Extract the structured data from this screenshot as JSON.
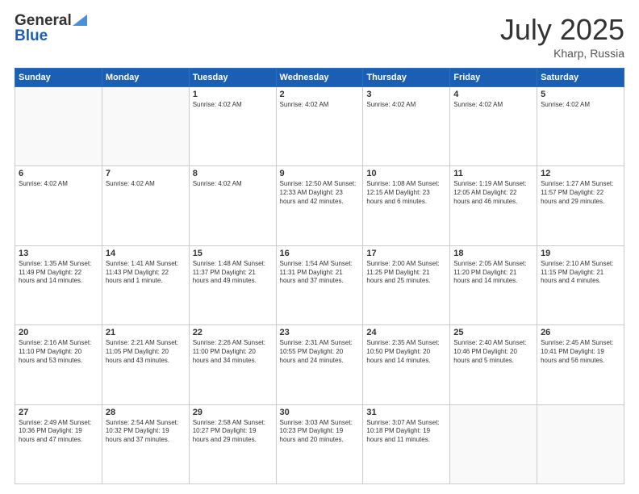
{
  "logo": {
    "line1": "General",
    "line2": "Blue"
  },
  "title": {
    "month_year": "July 2025",
    "location": "Kharp, Russia"
  },
  "weekdays": [
    "Sunday",
    "Monday",
    "Tuesday",
    "Wednesday",
    "Thursday",
    "Friday",
    "Saturday"
  ],
  "weeks": [
    [
      {
        "day": "",
        "info": ""
      },
      {
        "day": "",
        "info": ""
      },
      {
        "day": "1",
        "info": "Sunrise: 4:02 AM"
      },
      {
        "day": "2",
        "info": "Sunrise: 4:02 AM"
      },
      {
        "day": "3",
        "info": "Sunrise: 4:02 AM"
      },
      {
        "day": "4",
        "info": "Sunrise: 4:02 AM"
      },
      {
        "day": "5",
        "info": "Sunrise: 4:02 AM"
      }
    ],
    [
      {
        "day": "6",
        "info": "Sunrise: 4:02 AM"
      },
      {
        "day": "7",
        "info": "Sunrise: 4:02 AM"
      },
      {
        "day": "8",
        "info": "Sunrise: 4:02 AM"
      },
      {
        "day": "9",
        "info": "Sunrise: 12:50 AM\nSunset: 12:33 AM\nDaylight: 23 hours and 42 minutes."
      },
      {
        "day": "10",
        "info": "Sunrise: 1:08 AM\nSunset: 12:15 AM\nDaylight: 23 hours and 6 minutes."
      },
      {
        "day": "11",
        "info": "Sunrise: 1:19 AM\nSunset: 12:05 AM\nDaylight: 22 hours and 46 minutes."
      },
      {
        "day": "12",
        "info": "Sunrise: 1:27 AM\nSunset: 11:57 PM\nDaylight: 22 hours and 29 minutes."
      }
    ],
    [
      {
        "day": "13",
        "info": "Sunrise: 1:35 AM\nSunset: 11:49 PM\nDaylight: 22 hours and 14 minutes."
      },
      {
        "day": "14",
        "info": "Sunrise: 1:41 AM\nSunset: 11:43 PM\nDaylight: 22 hours and 1 minute."
      },
      {
        "day": "15",
        "info": "Sunrise: 1:48 AM\nSunset: 11:37 PM\nDaylight: 21 hours and 49 minutes."
      },
      {
        "day": "16",
        "info": "Sunrise: 1:54 AM\nSunset: 11:31 PM\nDaylight: 21 hours and 37 minutes."
      },
      {
        "day": "17",
        "info": "Sunrise: 2:00 AM\nSunset: 11:25 PM\nDaylight: 21 hours and 25 minutes."
      },
      {
        "day": "18",
        "info": "Sunrise: 2:05 AM\nSunset: 11:20 PM\nDaylight: 21 hours and 14 minutes."
      },
      {
        "day": "19",
        "info": "Sunrise: 2:10 AM\nSunset: 11:15 PM\nDaylight: 21 hours and 4 minutes."
      }
    ],
    [
      {
        "day": "20",
        "info": "Sunrise: 2:16 AM\nSunset: 11:10 PM\nDaylight: 20 hours and 53 minutes."
      },
      {
        "day": "21",
        "info": "Sunrise: 2:21 AM\nSunset: 11:05 PM\nDaylight: 20 hours and 43 minutes."
      },
      {
        "day": "22",
        "info": "Sunrise: 2:26 AM\nSunset: 11:00 PM\nDaylight: 20 hours and 34 minutes."
      },
      {
        "day": "23",
        "info": "Sunrise: 2:31 AM\nSunset: 10:55 PM\nDaylight: 20 hours and 24 minutes."
      },
      {
        "day": "24",
        "info": "Sunrise: 2:35 AM\nSunset: 10:50 PM\nDaylight: 20 hours and 14 minutes."
      },
      {
        "day": "25",
        "info": "Sunrise: 2:40 AM\nSunset: 10:46 PM\nDaylight: 20 hours and 5 minutes."
      },
      {
        "day": "26",
        "info": "Sunrise: 2:45 AM\nSunset: 10:41 PM\nDaylight: 19 hours and 56 minutes."
      }
    ],
    [
      {
        "day": "27",
        "info": "Sunrise: 2:49 AM\nSunset: 10:36 PM\nDaylight: 19 hours and 47 minutes."
      },
      {
        "day": "28",
        "info": "Sunrise: 2:54 AM\nSunset: 10:32 PM\nDaylight: 19 hours and 37 minutes."
      },
      {
        "day": "29",
        "info": "Sunrise: 2:58 AM\nSunset: 10:27 PM\nDaylight: 19 hours and 29 minutes."
      },
      {
        "day": "30",
        "info": "Sunrise: 3:03 AM\nSunset: 10:23 PM\nDaylight: 19 hours and 20 minutes."
      },
      {
        "day": "31",
        "info": "Sunrise: 3:07 AM\nSunset: 10:18 PM\nDaylight: 19 hours and 11 minutes."
      },
      {
        "day": "",
        "info": ""
      },
      {
        "day": "",
        "info": ""
      }
    ]
  ]
}
